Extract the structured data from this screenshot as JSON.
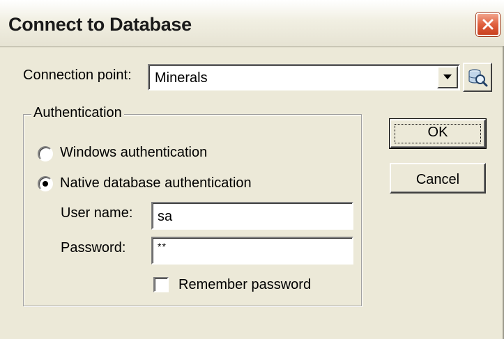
{
  "window": {
    "title": "Connect to Database"
  },
  "connection": {
    "label": "Connection point:",
    "selected": "Minerals"
  },
  "authentication": {
    "group_label": "Authentication",
    "windows_label": "Windows authentication",
    "windows_selected": false,
    "native_label": "Native database authentication",
    "native_selected": true,
    "username_label": "User name:",
    "username_value": "sa",
    "password_label": "Password:",
    "password_value": "**",
    "remember_label": "Remember password",
    "remember_checked": false
  },
  "buttons": {
    "ok": "OK",
    "cancel": "Cancel"
  },
  "icons": {
    "close": "close-icon",
    "dropdown": "chevron-down-icon",
    "database_browse": "database-search-icon"
  },
  "colors": {
    "dialog_background": "#ece9d8",
    "close_button": "#e0603f"
  }
}
